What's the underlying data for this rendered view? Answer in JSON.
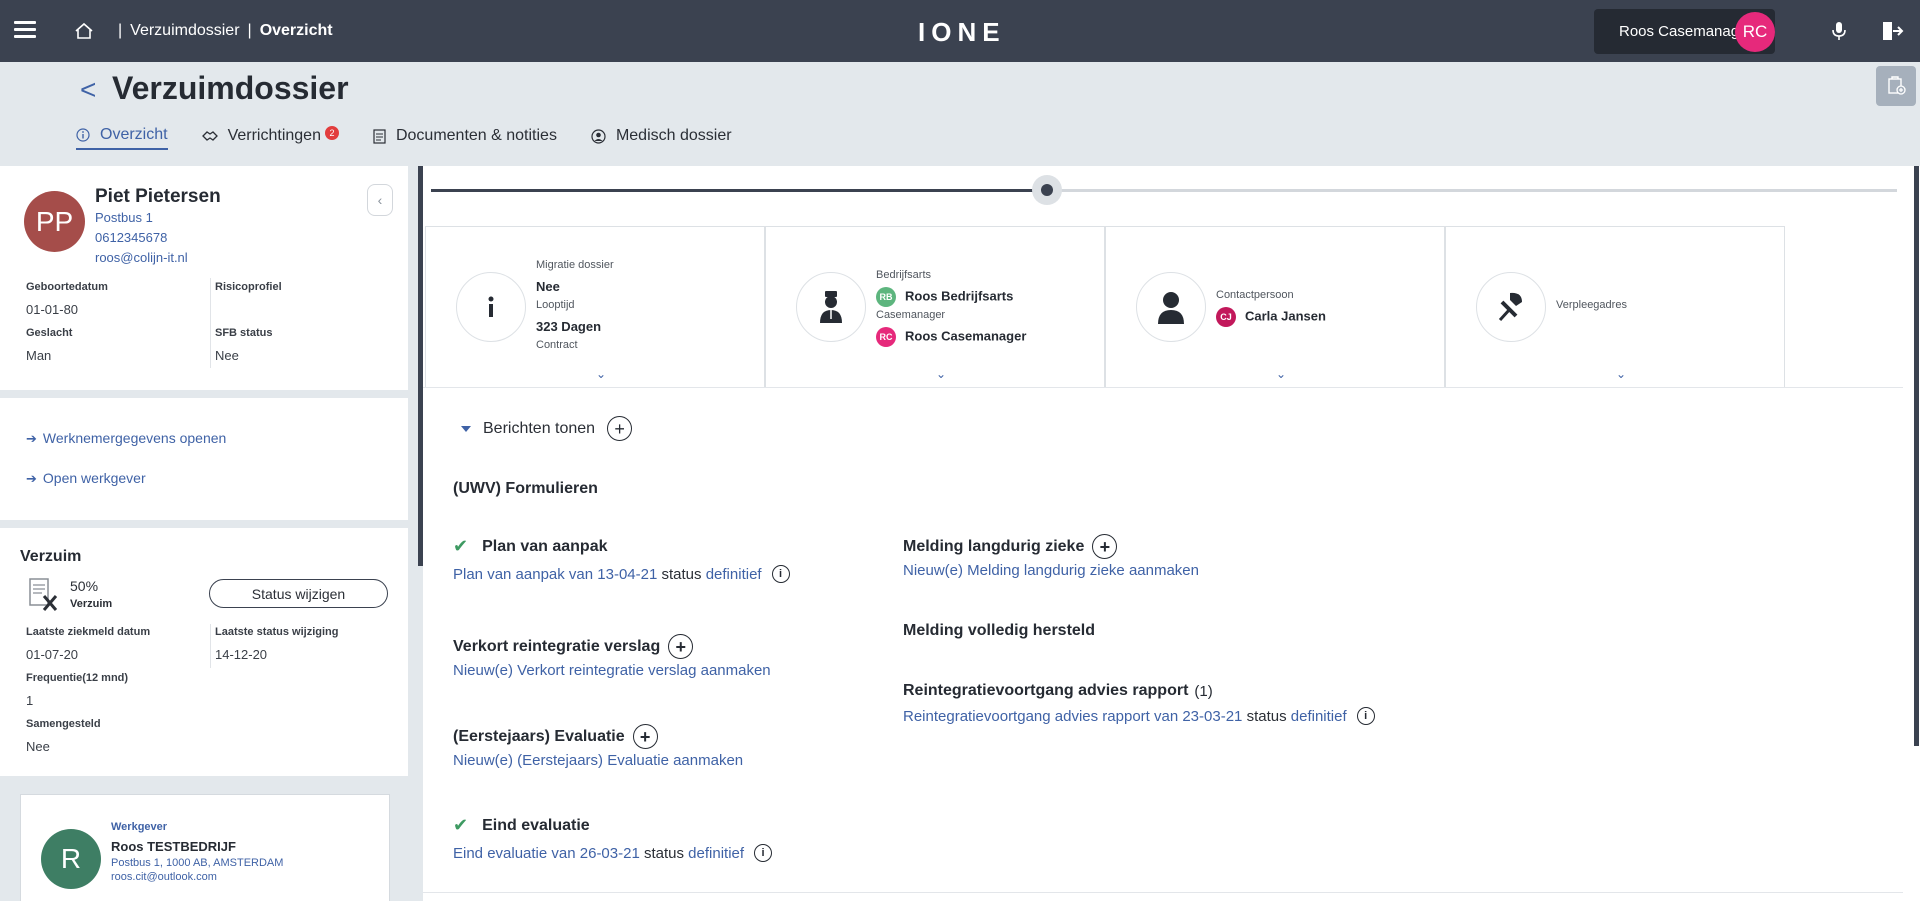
{
  "topbar": {
    "breadcrumb": [
      "Verzuimdossier",
      "Overzicht"
    ],
    "logo": "IONE",
    "user_name": "Roos Casemanager",
    "user_initials": "RC",
    "user_color": "#e6297b"
  },
  "header": {
    "title": "Verzuimdossier",
    "tabs": [
      {
        "label": "Overzicht",
        "active": true,
        "icon": "info-icon"
      },
      {
        "label": "Verrichtingen",
        "badge": "2",
        "icon": "handshake-icon"
      },
      {
        "label": "Documenten & notities",
        "icon": "document-icon"
      },
      {
        "label": "Medisch dossier",
        "icon": "doctor-icon"
      }
    ]
  },
  "employee": {
    "initials": "PP",
    "name": "Piet Pietersen",
    "address": "Postbus 1",
    "phone": "0612345678",
    "email": "roos@colijn-it.nl",
    "fields": {
      "geboortedatum_label": "Geboortedatum",
      "geboortedatum": "01-01-80",
      "risicoprofiel_label": "Risicoprofiel",
      "risicoprofiel": "",
      "geslacht_label": "Geslacht",
      "geslacht": "Man",
      "sfb_label": "SFB status",
      "sfb": "Nee"
    }
  },
  "actions": {
    "werknemer": "Werknemergegevens openen",
    "werkgever": "Open werkgever"
  },
  "verzuim": {
    "title": "Verzuim",
    "percentage": "50%",
    "status": "Verzuim",
    "status_button": "Status wijzigen",
    "laatste_ziekmeld_label": "Laatste ziekmeld datum",
    "laatste_ziekmeld": "01-07-20",
    "laatste_status_label": "Laatste status wijziging",
    "laatste_status": "14-12-20",
    "frequentie_label": "Frequentie(12 mnd)",
    "frequentie": "1",
    "samengesteld_label": "Samengesteld",
    "samengesteld": "Nee"
  },
  "werkgever": {
    "label": "Werkgever",
    "initial": "R",
    "name": "Roos TESTBEDRIJF",
    "address": "Postbus 1, 1000 AB, AMSTERDAM",
    "email": "roos.cit@outlook.com"
  },
  "timeline": {
    "progress": 0.42
  },
  "info_cards": {
    "migratie_label": "Migratie dossier",
    "migratie": "Nee",
    "looptijd_label": "Looptijd",
    "looptijd": "323 Dagen",
    "contract_label": "Contract",
    "bedrijfsarts_label": "Bedrijfsarts",
    "bedrijfsarts_initials": "RB",
    "bedrijfsarts": "Roos Bedrijfsarts",
    "casemanager_label": "Casemanager",
    "casemanager_initials": "RC",
    "casemanager": "Roos Casemanager",
    "contactpersoon_label": "Contactpersoon",
    "contactpersoon_initials": "CJ",
    "contactpersoon": "Carla Jansen",
    "verpleegadres_label": "Verpleegadres"
  },
  "messages": {
    "toggle": "Berichten tonen"
  },
  "forms": {
    "section_title": "(UWV) Formulieren",
    "plan": {
      "title": "Plan van aanpak",
      "link": "Plan van aanpak van 13-04-21",
      "status_word": "status",
      "status": "definitief"
    },
    "melding_langdurig": {
      "title": "Melding langdurig zieke",
      "link": "Nieuw(e) Melding langdurig zieke aanmaken"
    },
    "melding_hersteld": {
      "title": "Melding volledig hersteld"
    },
    "verkort": {
      "title": "Verkort reintegratie verslag",
      "link": "Nieuw(e) Verkort reintegratie verslag aanmaken"
    },
    "advies": {
      "title": "Reintegratievoortgang advies rapport",
      "count": "(1)",
      "link": "Reintegratievoortgang advies rapport van 23-03-21",
      "status_word": "status",
      "status": "definitief"
    },
    "eerstejaars": {
      "title": "(Eerstejaars) Evaluatie",
      "link": "Nieuw(e) (Eerstejaars) Evaluatie aanmaken"
    },
    "eind": {
      "title": "Eind evaluatie",
      "link": "Eind evaluatie van 26-03-21",
      "status_word": "status",
      "status": "definitief"
    }
  }
}
